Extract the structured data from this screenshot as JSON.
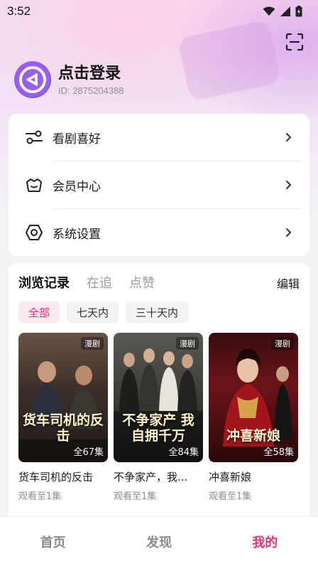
{
  "status_bar": {
    "time": "3:52"
  },
  "profile": {
    "title": "点击登录",
    "user_id": "ID: 2875204388"
  },
  "menu": [
    {
      "label": "看剧喜好",
      "icon": "preferences-sliders-icon"
    },
    {
      "label": "会员中心",
      "icon": "vip-crown-icon"
    },
    {
      "label": "系统设置",
      "icon": "settings-gear-icon"
    }
  ],
  "history": {
    "tabs": [
      "浏览记录",
      "在追",
      "点赞"
    ],
    "active_tab": "浏览记录",
    "edit_label": "编辑",
    "filters": [
      "全部",
      "七天内",
      "三十天内"
    ],
    "active_filter": "全部",
    "dramas": [
      {
        "title": "货车司机的反击",
        "tag": "漫剧",
        "episodes": "全67集",
        "progress": "观看至1集",
        "poster_text": "货车司机的反击"
      },
      {
        "title": "不争家产，我...",
        "tag": "漫剧",
        "episodes": "全84集",
        "progress": "观看至1集",
        "poster_text": "不争家产 我自拥千万"
      },
      {
        "title": "冲喜新娘",
        "tag": "漫剧",
        "episodes": "全58集",
        "progress": "观看至1集",
        "poster_text": "冲喜新娘"
      }
    ]
  },
  "bottom_nav": {
    "items": [
      "首页",
      "发现",
      "我的"
    ],
    "active": "我的"
  },
  "colors": {
    "accent": "#e8336f",
    "accent_bg": "#fde8f0",
    "avatar": "#8a58f0"
  }
}
